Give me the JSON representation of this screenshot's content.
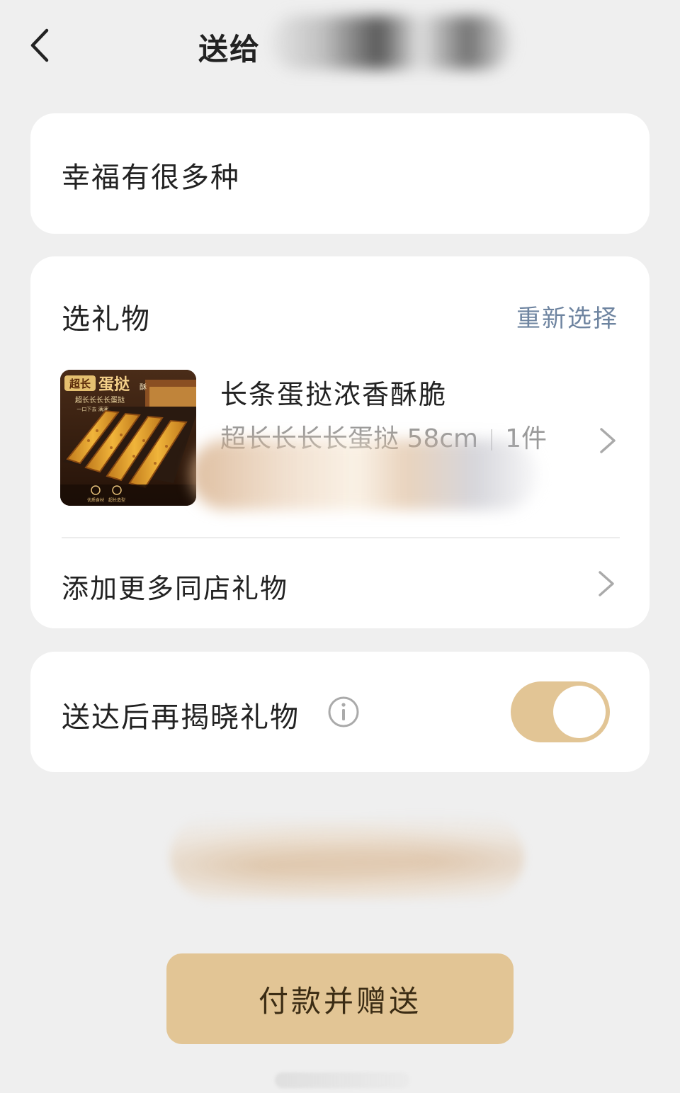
{
  "header": {
    "back_icon": "chevron-left-icon",
    "title": "送给"
  },
  "message": {
    "text": "幸福有很多种"
  },
  "gift": {
    "section_title": "选礼物",
    "reselect_label": "重新选择",
    "product": {
      "name": "长条蛋挞浓香酥脆",
      "spec": "超长长长长蛋挞 58cm",
      "quantity": "1件",
      "thumbnail": {
        "badge_top": "超长",
        "badge_main": "蛋挞",
        "side_tag": "酥",
        "tagline": "超长长长长蛋挞",
        "subtagline": "一口下去 满满幸福感",
        "feature_1": "优质食材",
        "feature_2": "超长造型"
      }
    },
    "add_more_label": "添加更多同店礼物"
  },
  "reveal": {
    "label": "送达后再揭晓礼物",
    "info_icon": "info-circle-icon",
    "toggle_on": true
  },
  "actions": {
    "pay_label": "付款并赠送"
  },
  "colors": {
    "background": "#efefef",
    "card": "#ffffff",
    "accent_gold": "#e2c595",
    "link_blue": "#6e84a0",
    "muted_text": "#9a9a9a"
  }
}
